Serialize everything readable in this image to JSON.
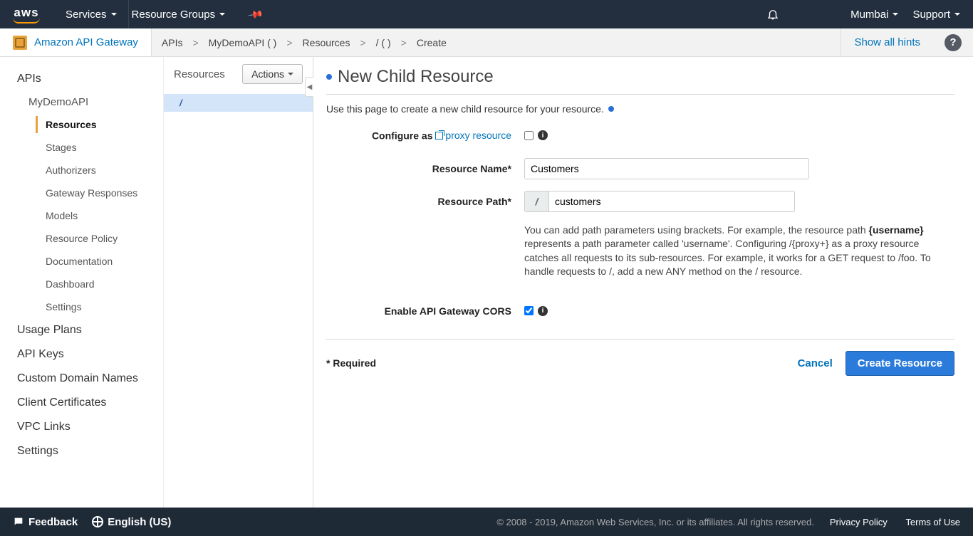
{
  "topnav": {
    "logo": "aws",
    "services": "Services",
    "resource_groups": "Resource Groups",
    "region": "Mumbai",
    "support": "Support"
  },
  "subnav": {
    "service_name": "Amazon API Gateway",
    "crumbs": [
      "APIs",
      "MyDemoAPI (                    )",
      "Resources",
      "/ (                 )",
      "Create"
    ],
    "hints": "Show all hints"
  },
  "leftnav": {
    "apis": "APIs",
    "api_name": "MyDemoAPI",
    "items": [
      "Resources",
      "Stages",
      "Authorizers",
      "Gateway Responses",
      "Models",
      "Resource Policy",
      "Documentation",
      "Dashboard",
      "Settings"
    ],
    "top_items": [
      "Usage Plans",
      "API Keys",
      "Custom Domain Names",
      "Client Certificates",
      "VPC Links",
      "Settings"
    ]
  },
  "rescol": {
    "title": "Resources",
    "actions": "Actions",
    "root": "/"
  },
  "content": {
    "title": "New Child Resource",
    "subtitle": "Use this page to create a new child resource for your resource.",
    "labels": {
      "configure_as": "Configure as",
      "proxy_link": "proxy resource",
      "resource_name": "Resource Name*",
      "resource_path": "Resource Path*",
      "cors": "Enable API Gateway CORS"
    },
    "values": {
      "resource_name": "Customers",
      "path_prefix": "/",
      "resource_path": "customers"
    },
    "helptext_pre": "You can add path parameters using brackets. For example, the resource path ",
    "helptext_bold": "{username}",
    "helptext_post": " represents a path parameter called 'username'. Configuring /{proxy+} as a proxy resource catches all requests to its sub-resources. For example, it works for a GET request to /foo. To handle requests to /, add a new ANY method on the / resource.",
    "required": "* Required",
    "cancel": "Cancel",
    "create": "Create Resource"
  },
  "statusbar": {
    "feedback": "Feedback",
    "language": "English (US)",
    "copyright": "© 2008 - 2019, Amazon Web Services, Inc. or its affiliates. All rights reserved.",
    "privacy": "Privacy Policy",
    "terms": "Terms of Use"
  }
}
